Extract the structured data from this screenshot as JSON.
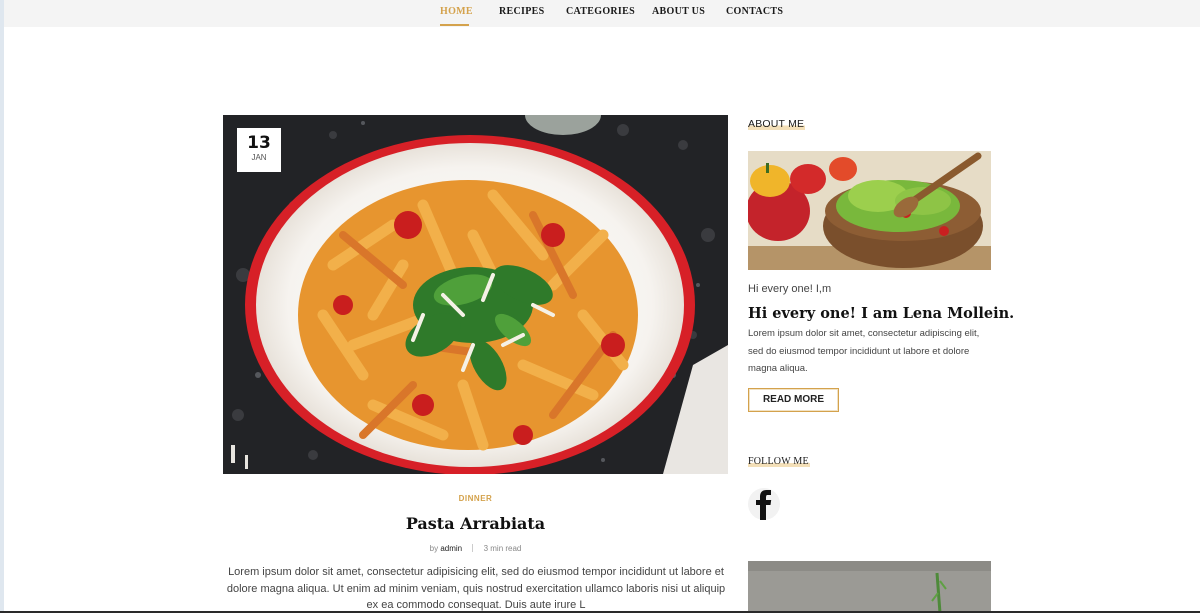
{
  "nav": {
    "items": [
      {
        "label": "HOME",
        "active": true
      },
      {
        "label": "RECIPES",
        "active": false
      },
      {
        "label": "CATEGORIES",
        "active": false
      },
      {
        "label": "ABOUT US",
        "active": false
      },
      {
        "label": "CONTACTS",
        "active": false
      }
    ]
  },
  "post": {
    "date_day": "13",
    "date_month": "JAN",
    "category": "DINNER",
    "title": "Pasta Arrabiata",
    "by_label": "by",
    "author": "admin",
    "read_time": "3 min read",
    "excerpt": "Lorem ipsum dolor sit amet, consectetur adipisicing elit, sed do eiusmod tempor incididunt ut labore et dolore magna aliqua. Ut enim ad minim veniam, quis nostrud exercitation ullamco laboris nisi ut aliquip ex ea commodo consequat. Duis aute irure L"
  },
  "sidebar": {
    "about_heading": "ABOUT ME",
    "greeting": "Hi every one! I,m",
    "name_line": "Hi every one! I am Lena Mollein.",
    "about_text": "Lorem ipsum dolor sit amet, consectetur adipiscing elit, sed do eiusmod tempor incididunt ut labore et dolore magna aliqua.",
    "read_more_label": "READ MORE",
    "follow_heading": "FOLLOW ME",
    "social": [
      {
        "icon": "facebook-icon"
      }
    ]
  },
  "colors": {
    "accent": "#d4a24c",
    "nav_bg": "#f4f4f4",
    "text_dark": "#111111"
  }
}
